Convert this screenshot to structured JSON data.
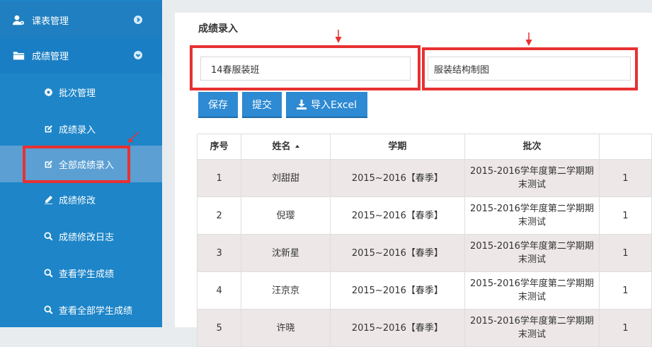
{
  "sidebar": {
    "sections": [
      {
        "label": "课表管理",
        "icon": "user-settings-icon"
      },
      {
        "label": "成绩管理",
        "icon": "folder-icon"
      }
    ],
    "items": [
      {
        "label": "批次管理",
        "icon": "gear-icon"
      },
      {
        "label": "成绩录入",
        "icon": "edit-icon"
      },
      {
        "label": "全部成绩录入",
        "icon": "edit-icon",
        "active": true
      },
      {
        "label": "成绩修改",
        "icon": "pencil-icon"
      },
      {
        "label": "成绩修改日志",
        "icon": "search-icon"
      },
      {
        "label": "查看学生成绩",
        "icon": "search-icon"
      },
      {
        "label": "查看全部学生成绩",
        "icon": "search-icon"
      }
    ]
  },
  "page": {
    "title": "成绩录入",
    "class_value": "14春服装班",
    "course_value": "服装结构制图"
  },
  "toolbar": {
    "save_label": "保存",
    "submit_label": "提交",
    "import_label": "导入Excel"
  },
  "table": {
    "headers": [
      "序号",
      "姓名",
      "学期",
      "批次"
    ],
    "rows": [
      {
        "no": "1",
        "name": "刘甜甜",
        "term": "2015~2016【春季】",
        "batch_line1": "2015-2016学年度第二学期期",
        "batch_line2": "末测试",
        "extra": "1"
      },
      {
        "no": "2",
        "name": "倪璎",
        "term": "2015~2016【春季】",
        "batch_line1": "2015-2016学年度第二学期期",
        "batch_line2": "末测试",
        "extra": "1"
      },
      {
        "no": "3",
        "name": "沈新星",
        "term": "2015~2016【春季】",
        "batch_line1": "2015-2016学年度第二学期期",
        "batch_line2": "末测试",
        "extra": "1"
      },
      {
        "no": "4",
        "name": "汪京京",
        "term": "2015~2016【春季】",
        "batch_line1": "2015-2016学年度第二学期期",
        "batch_line2": "末测试",
        "extra": "1"
      },
      {
        "no": "5",
        "name": "许晓",
        "term": "2015~2016【春季】",
        "batch_line1": "2015-2016学年度第二学期期",
        "batch_line2": "末测试",
        "extra": "1"
      }
    ]
  },
  "annotations": {
    "color": "#e83131"
  },
  "colors": {
    "sidebar": "#1d85c8",
    "sidebar_active": "#5b9fd3",
    "button": "#2d8ad3",
    "row_alt": "#ede7e7"
  }
}
